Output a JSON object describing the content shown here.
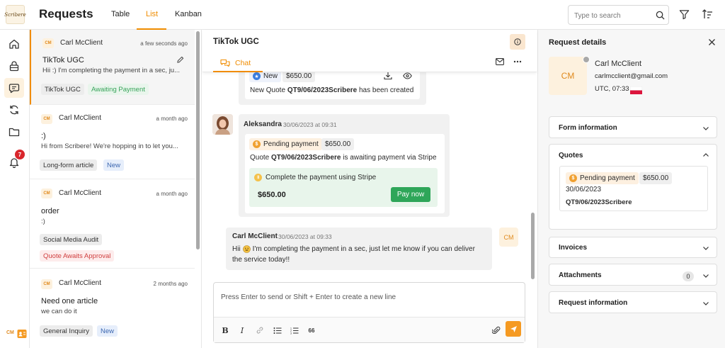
{
  "header": {
    "logo_text": "Scribere",
    "title": "Requests",
    "tabs": [
      {
        "label": "Table"
      },
      {
        "label": "List"
      },
      {
        "label": "Kanban"
      }
    ],
    "search_placeholder": "Type to search"
  },
  "rail": {
    "items": [
      {
        "icon": "home-icon"
      },
      {
        "icon": "lock-icon"
      },
      {
        "icon": "chat-icon"
      },
      {
        "icon": "sync-icon"
      },
      {
        "icon": "folder-icon"
      },
      {
        "icon": "bell-icon"
      }
    ],
    "notification_count": "7",
    "me_initials": "CM"
  },
  "list": {
    "items": [
      {
        "initials": "CM",
        "name": "Carl McClient",
        "time": "a few seconds ago",
        "title": "TikTok UGC",
        "snippet": "Hii :) I'm completing the payment in a sec, ju...",
        "tags": [
          "TikTok UGC",
          "Awaiting Payment"
        ]
      },
      {
        "initials": "CM",
        "name": "Carl McClient",
        "time": "a month ago",
        "title": ":)",
        "snippet": "Hi from Scribere! We're hopping in to let you...",
        "tags": [
          "Long-form article",
          "New"
        ]
      },
      {
        "initials": "CM",
        "name": "Carl McClient",
        "time": "a month ago",
        "title": "order",
        "snippet": ":)",
        "tags": [
          "Social Media Audit",
          "Quote Awaits Approval"
        ]
      },
      {
        "initials": "CM",
        "name": "Carl McClient",
        "time": "2 months ago",
        "title": "Need one article",
        "snippet": "we can do it",
        "tags": [
          "General Inquiry",
          "New"
        ]
      }
    ]
  },
  "chat": {
    "title": "TikTok UGC",
    "tab_label": "Chat",
    "messages": [
      {
        "status": "New",
        "amount": "$650.00",
        "text_prefix": "New Quote ",
        "quote_id": "QT9/06/2023Scribere",
        "text_suffix": " has been created"
      },
      {
        "sender": "Aleksandra",
        "time": "30/06/2023 at 09:31",
        "status": "Pending payment",
        "amount": "$650.00",
        "text_prefix": "Quote ",
        "quote_id": "QT9/06/2023Scribere",
        "text_suffix": " is awaiting payment via Stripe",
        "payment_prompt": "Complete the payment using Stripe",
        "payment_amount": "$650.00",
        "pay_button": "Pay now"
      },
      {
        "sender": "Carl McClient",
        "time": "30/06/2023 at 09:33",
        "initials": "CM",
        "line1_a": "Hii",
        "line1_b": "I'm completing the payment in a sec, just let me know if you can deliver",
        "line2": "the service today!!"
      }
    ],
    "composer_placeholder": "Press Enter to send or Shift + Enter to create a new line",
    "quote_glyph": "66"
  },
  "details": {
    "title": "Request details",
    "initials": "CM",
    "name": "Carl McClient",
    "email": "carlmcclient@gmail.com",
    "timezone": "UTC, 07:33",
    "sections": {
      "form": "Form information",
      "quotes": "Quotes",
      "invoices": "Invoices",
      "attachments": "Attachments",
      "attachments_count": "0",
      "request": "Request information"
    },
    "quote": {
      "status": "Pending payment",
      "amount": "$650.00",
      "date": "30/06/2023",
      "id": "QT9/06/2023Scribere"
    }
  },
  "colors": {
    "accent": "#f08c00",
    "accent_soft": "#fdf1de",
    "success": "#2ea659",
    "danger": "#d9262c"
  }
}
